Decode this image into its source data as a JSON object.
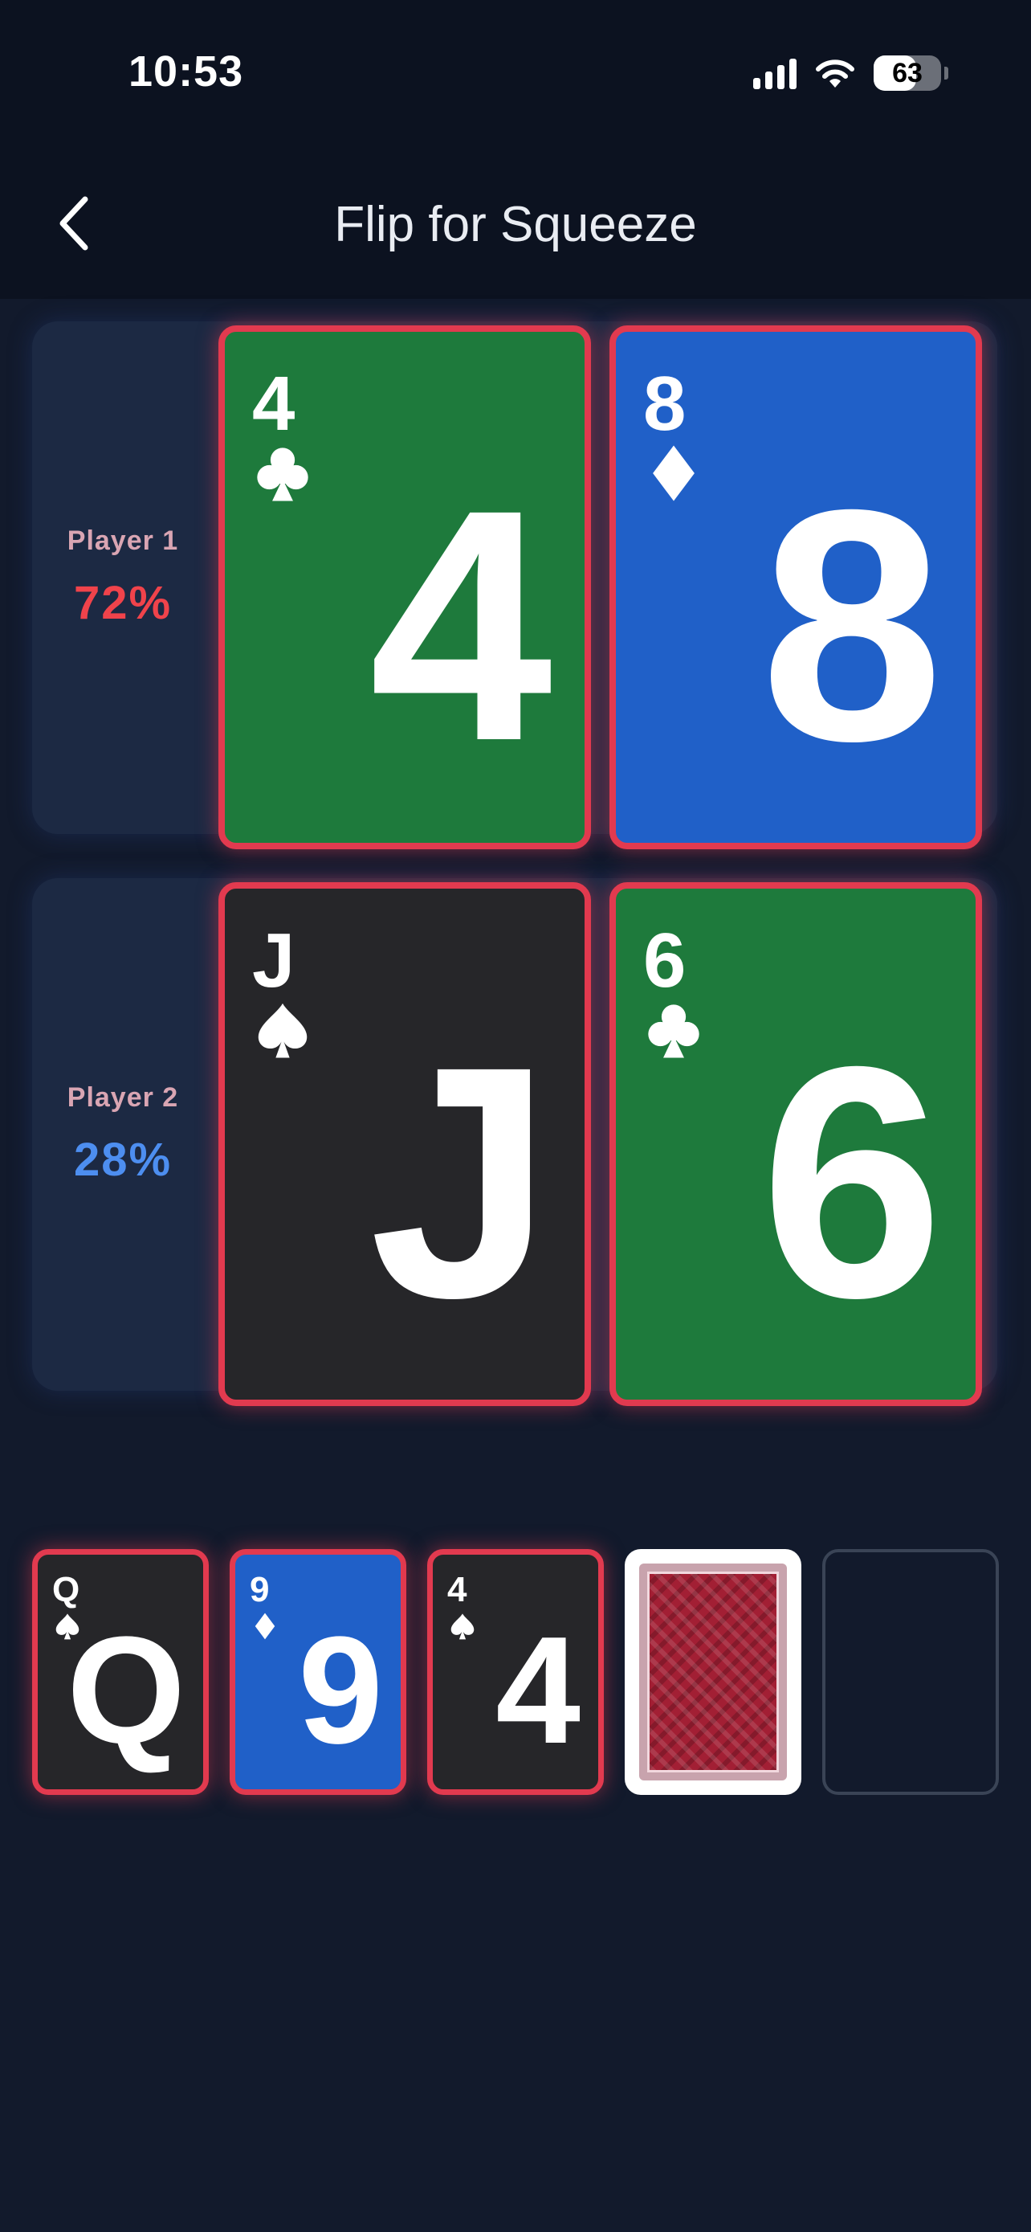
{
  "status_bar": {
    "time": "10:53",
    "battery_level": "63",
    "icons": [
      "signal-icon",
      "wifi-icon",
      "battery-icon"
    ]
  },
  "nav": {
    "back_icon": "chevron-left-icon",
    "title": "Flip for Squeeze"
  },
  "players": [
    {
      "name": "Player 1",
      "percent": "72%",
      "percent_color": "#f0434b",
      "cards": [
        {
          "rank": "4",
          "suit": "clubs",
          "color": "#1e7a3c"
        },
        {
          "rank": "8",
          "suit": "diamonds",
          "color": "#2060c8"
        }
      ]
    },
    {
      "name": "Player 2",
      "percent": "28%",
      "percent_color": "#4d8ef0",
      "cards": [
        {
          "rank": "J",
          "suit": "spades",
          "color": "#262629"
        },
        {
          "rank": "6",
          "suit": "clubs",
          "color": "#1e7a3c"
        }
      ]
    }
  ],
  "board": {
    "cards": [
      {
        "rank": "Q",
        "suit": "spades",
        "color": "#262629"
      },
      {
        "rank": "9",
        "suit": "diamonds",
        "color": "#2060c8"
      },
      {
        "rank": "4",
        "suit": "spades",
        "color": "#262629"
      }
    ],
    "face_down": 1,
    "empty_slots": 1
  },
  "colors": {
    "accent_border": "#e23a4f",
    "background": "#121a2c",
    "panel": "#1c2943"
  }
}
